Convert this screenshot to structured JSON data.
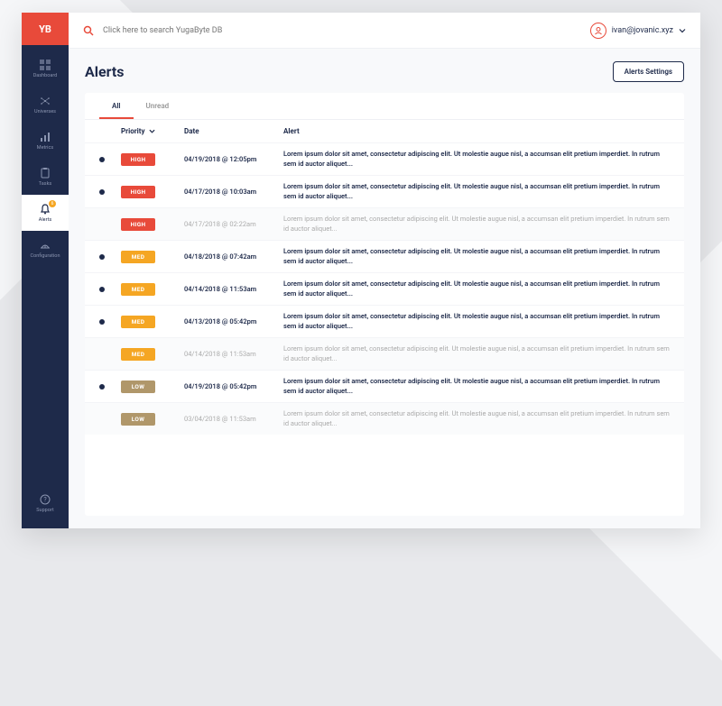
{
  "logo": "YB",
  "search": {
    "placeholder": "Click here to search YugaByte DB"
  },
  "user": {
    "email": "ivan@jovanic.xyz"
  },
  "sidebar": {
    "items": [
      {
        "label": "Dashboard"
      },
      {
        "label": "Universes"
      },
      {
        "label": "Metrics"
      },
      {
        "label": "Tasks"
      },
      {
        "label": "Alerts",
        "badge": "6"
      },
      {
        "label": "Configuration"
      }
    ],
    "support": "Support"
  },
  "page": {
    "title": "Alerts",
    "settings_btn": "Alerts Settings"
  },
  "tabs": [
    {
      "label": "All",
      "active": true
    },
    {
      "label": "Unread",
      "active": false
    }
  ],
  "columns": {
    "priority": "Priority",
    "date": "Date",
    "alert": "Alert"
  },
  "alerts": [
    {
      "unread": true,
      "priority": "HIGH",
      "date": "04/19/2018 @ 12:05pm",
      "text": "Lorem ipsum dolor sit amet, consectetur adipiscing elit. Ut molestie augue nisl, a accumsan elit pretium imperdiet. In rutrum sem id auctor aliquet..."
    },
    {
      "unread": true,
      "priority": "HIGH",
      "date": "04/17/2018 @ 10:03am",
      "text": "Lorem ipsum dolor sit amet, consectetur adipiscing elit. Ut molestie augue nisl, a accumsan elit pretium imperdiet. In rutrum sem id auctor aliquet..."
    },
    {
      "unread": false,
      "priority": "HIGH",
      "date": "04/17/2018 @ 02:22am",
      "text": "Lorem ipsum dolor sit amet, consectetur adipiscing elit. Ut molestie augue nisl, a accumsan elit pretium imperdiet. In rutrum sem id auctor aliquet..."
    },
    {
      "unread": true,
      "priority": "MED",
      "date": "04/18/2018 @ 07:42am",
      "text": "Lorem ipsum dolor sit amet, consectetur adipiscing elit. Ut molestie augue nisl, a accumsan elit pretium imperdiet. In rutrum sem id auctor aliquet..."
    },
    {
      "unread": true,
      "priority": "MED",
      "date": "04/14/2018 @ 11:53am",
      "text": "Lorem ipsum dolor sit amet, consectetur adipiscing elit. Ut molestie augue nisl, a accumsan elit pretium imperdiet. In rutrum sem id auctor aliquet..."
    },
    {
      "unread": true,
      "priority": "MED",
      "date": "04/13/2018 @ 05:42pm",
      "text": "Lorem ipsum dolor sit amet, consectetur adipiscing elit. Ut molestie augue nisl, a accumsan elit pretium imperdiet. In rutrum sem id auctor aliquet..."
    },
    {
      "unread": false,
      "priority": "MED",
      "date": "04/14/2018 @ 11:53am",
      "text": "Lorem ipsum dolor sit amet, consectetur adipiscing elit. Ut molestie augue nisl, a accumsan elit pretium imperdiet. In rutrum sem id auctor aliquet..."
    },
    {
      "unread": true,
      "priority": "LOW",
      "date": "04/19/2018 @ 05:42pm",
      "text": "Lorem ipsum dolor sit amet, consectetur adipiscing elit. Ut molestie augue nisl, a accumsan elit pretium imperdiet. In rutrum sem id auctor aliquet..."
    },
    {
      "unread": false,
      "priority": "LOW",
      "date": "03/04/2018 @ 11:53am",
      "text": "Lorem ipsum dolor sit amet, consectetur adipiscing elit. Ut molestie augue nisl, a accumsan elit pretium imperdiet. In rutrum sem id auctor aliquet..."
    }
  ]
}
